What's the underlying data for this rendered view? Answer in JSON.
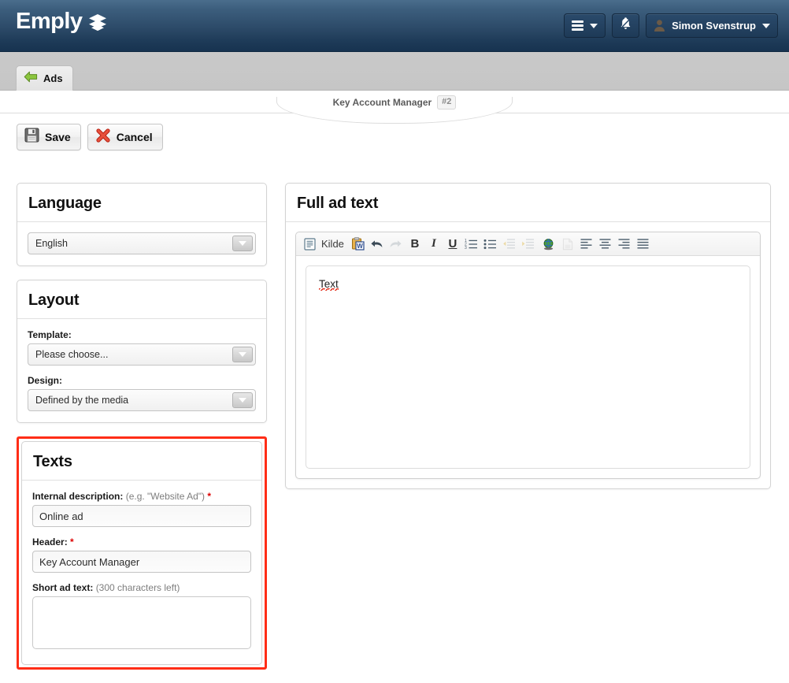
{
  "header": {
    "brand": "Emply",
    "brand_mark_icon": "emply-leaf-logo-icon",
    "menu_icon": "hamburger-menu-icon",
    "menu_caret_icon": "chevron-down-icon",
    "notifications_icon": "bell-icon",
    "user_avatar_icon": "user-avatar-icon",
    "user_name": "Simon Svenstrup",
    "user_caret_icon": "chevron-down-icon"
  },
  "tabbar": {
    "back_arrow_icon": "green-back-arrow-icon",
    "ads_tab": "Ads"
  },
  "breadcrumb": {
    "title": "Key Account Manager",
    "badge": "#2"
  },
  "toolbar": {
    "save_icon": "floppy-disk-save-icon",
    "save_label": "Save",
    "cancel_icon": "red-x-cancel-icon",
    "cancel_label": "Cancel"
  },
  "language_panel": {
    "title": "Language",
    "value": "English",
    "caret_icon": "chevron-down-icon"
  },
  "layout_panel": {
    "title": "Layout",
    "template_label": "Template:",
    "template_value": "Please choose...",
    "design_label": "Design:",
    "design_value": "Defined by the media",
    "caret_icon": "chevron-down-icon"
  },
  "texts_panel": {
    "title": "Texts",
    "internal_description_label": "Internal description:",
    "internal_description_hint": "(e.g. \"Website Ad\")",
    "internal_description_required": "*",
    "internal_description_value": "Online ad",
    "header_label": "Header:",
    "header_required": "*",
    "header_value": "Key Account Manager",
    "short_ad_text_label": "Short ad text:",
    "short_ad_text_hint": "(300 characters left)",
    "short_ad_text_value": "",
    "highlight_color": "#ff2d17"
  },
  "full_ad_text_panel": {
    "title": "Full ad text",
    "editor_content": "Text",
    "toolbar": {
      "source_icon": "source-view-icon",
      "source_label": "Kilde",
      "paste_word_icon": "paste-from-word-icon",
      "undo_icon": "undo-arrow-icon",
      "redo_icon": "redo-arrow-icon",
      "bold_label": "B",
      "italic_label": "I",
      "underline_label": "U",
      "numbered_list_icon": "numbered-list-icon",
      "bulleted_list_icon": "bulleted-list-icon",
      "outdent_icon": "outdent-icon",
      "indent_icon": "indent-icon",
      "link_icon": "insert-link-globe-icon",
      "unlink_icon": "unlink-icon",
      "align_left_icon": "align-left-icon",
      "align_center_icon": "align-center-icon",
      "align_right_icon": "align-right-icon",
      "align_justify_icon": "align-justify-icon"
    }
  }
}
